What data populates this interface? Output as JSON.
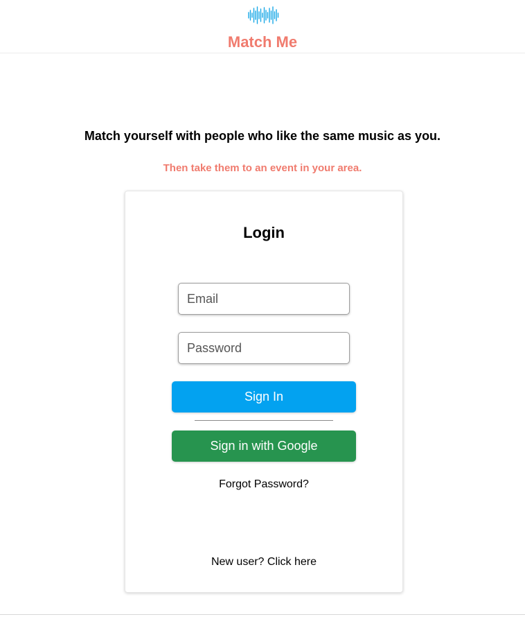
{
  "header": {
    "logo_icon": "soundwave-icon",
    "brand_name": "Match Me",
    "brand_color": "#f07b6e",
    "logo_color": "#1aa8e6"
  },
  "hero": {
    "tagline": "Match yourself with people who like the same music as you.",
    "subtagline": "Then take them to an event in your area."
  },
  "login": {
    "title": "Login",
    "email_placeholder": "Email",
    "email_value": "",
    "password_placeholder": "Password",
    "password_value": "",
    "signin_label": "Sign In",
    "signin_color": "#03a2f0",
    "google_label": "Sign in with Google",
    "google_color": "#27944f",
    "forgot_label": "Forgot Password?",
    "new_user_label": "New user? Click here"
  }
}
